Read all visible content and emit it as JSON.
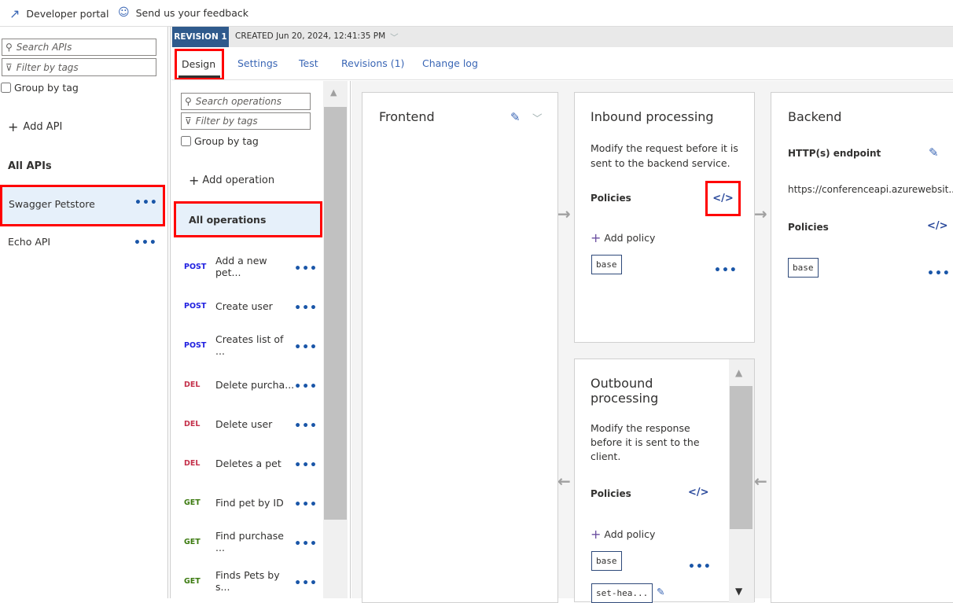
{
  "topbar": {
    "developer_portal": "Developer portal",
    "feedback": "Send us your feedback"
  },
  "apis": {
    "search_placeholder": "Search APIs",
    "filter_placeholder": "Filter by tags",
    "group_by_tag": "Group by tag",
    "add_api": "Add API",
    "all_apis": "All APIs",
    "items": [
      {
        "name": "Swagger Petstore",
        "selected": true
      },
      {
        "name": "Echo API",
        "selected": false
      }
    ]
  },
  "revision": {
    "badge": "REVISION 1",
    "created": "CREATED Jun 20, 2024, 12:41:35 PM"
  },
  "tabs": [
    {
      "label": "Design",
      "active": true
    },
    {
      "label": "Settings"
    },
    {
      "label": "Test"
    },
    {
      "label": "Revisions (1)"
    },
    {
      "label": "Change log"
    }
  ],
  "operations": {
    "search_placeholder": "Search operations",
    "filter_placeholder": "Filter by tags",
    "group_by_tag": "Group by tag",
    "add_operation": "Add operation",
    "all_operations": "All operations",
    "items": [
      {
        "method": "POST",
        "name": "Add a new pet..."
      },
      {
        "method": "POST",
        "name": "Create user"
      },
      {
        "method": "POST",
        "name": "Creates list of ..."
      },
      {
        "method": "DEL",
        "name": "Delete purcha..."
      },
      {
        "method": "DEL",
        "name": "Delete user"
      },
      {
        "method": "DEL",
        "name": "Deletes a pet"
      },
      {
        "method": "GET",
        "name": "Find pet by ID"
      },
      {
        "method": "GET",
        "name": "Find purchase ..."
      },
      {
        "method": "GET",
        "name": "Finds Pets by s..."
      }
    ]
  },
  "method_colors": {
    "POST": "#1f1fe0",
    "DEL": "#c4314b",
    "GET": "#3b7a0f"
  },
  "frontend": {
    "title": "Frontend"
  },
  "inbound": {
    "title": "Inbound processing",
    "description": "Modify the request before it is sent to the backend service.",
    "policies": "Policies",
    "add_policy": "Add policy",
    "policy_items": [
      "base"
    ]
  },
  "outbound": {
    "title": "Outbound processing",
    "description": "Modify the response before it is sent to the client.",
    "policies": "Policies",
    "add_policy": "Add policy",
    "policy_items": [
      "base",
      "set-hea..."
    ]
  },
  "backend": {
    "title": "Backend",
    "endpoint_label": "HTTP(s) endpoint",
    "endpoint_url": "https://conferenceapi.azurewebsit...",
    "policies": "Policies",
    "policy_items": [
      "base"
    ]
  }
}
